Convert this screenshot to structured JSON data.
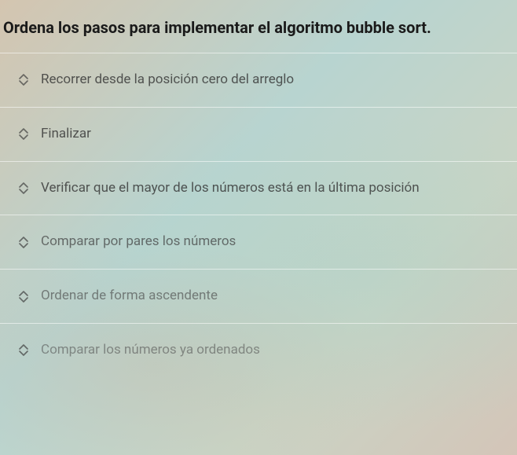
{
  "question": {
    "title": "Ordena los pasos para implementar el algoritmo bubble sort."
  },
  "items": [
    {
      "text": "Recorrer desde la posición cero del arreglo"
    },
    {
      "text": "Finalizar"
    },
    {
      "text": "Verificar que el mayor de los números está en la última posición"
    },
    {
      "text": "Comparar por pares los números"
    },
    {
      "text": "Ordenar de forma ascendente"
    },
    {
      "text": "Comparar los números ya ordenados"
    }
  ]
}
